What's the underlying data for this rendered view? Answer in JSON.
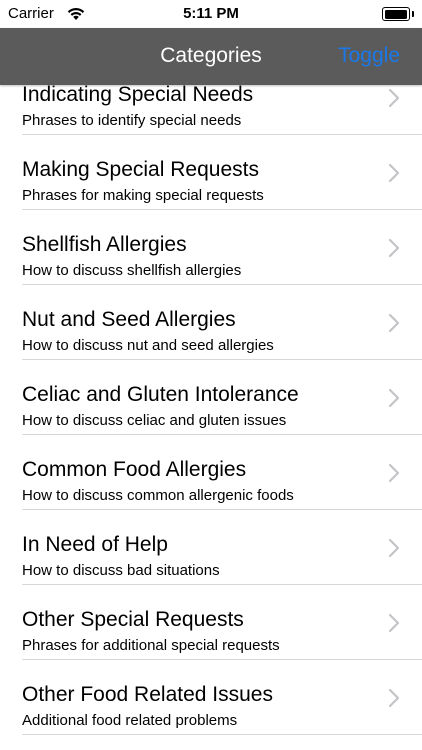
{
  "status": {
    "carrier": "Carrier",
    "time": "5:11 PM"
  },
  "nav": {
    "title": "Categories",
    "toggle": "Toggle"
  },
  "rows": [
    {
      "title": "Indicating Special Needs",
      "subtitle": "Phrases to identify special needs"
    },
    {
      "title": "Making Special Requests",
      "subtitle": "Phrases for making special requests"
    },
    {
      "title": "Shellfish Allergies",
      "subtitle": "How to discuss shellfish allergies"
    },
    {
      "title": "Nut and Seed Allergies",
      "subtitle": "How to discuss nut and seed allergies"
    },
    {
      "title": "Celiac and Gluten Intolerance",
      "subtitle": "How to discuss celiac and gluten issues"
    },
    {
      "title": "Common Food Allergies",
      "subtitle": "How to discuss common allergenic foods"
    },
    {
      "title": "In Need of Help",
      "subtitle": "How to discuss bad situations"
    },
    {
      "title": "Other Special Requests",
      "subtitle": "Phrases for additional special requests"
    },
    {
      "title": "Other Food Related Issues",
      "subtitle": "Additional food related problems"
    }
  ],
  "colors": {
    "nav_bg": "#5b5b5b",
    "accent": "#1a78e8",
    "separator": "#d7d7dc"
  },
  "icons": {
    "row_accessory": "chevron-right-icon",
    "wifi": "wifi-icon",
    "battery": "battery-icon"
  }
}
